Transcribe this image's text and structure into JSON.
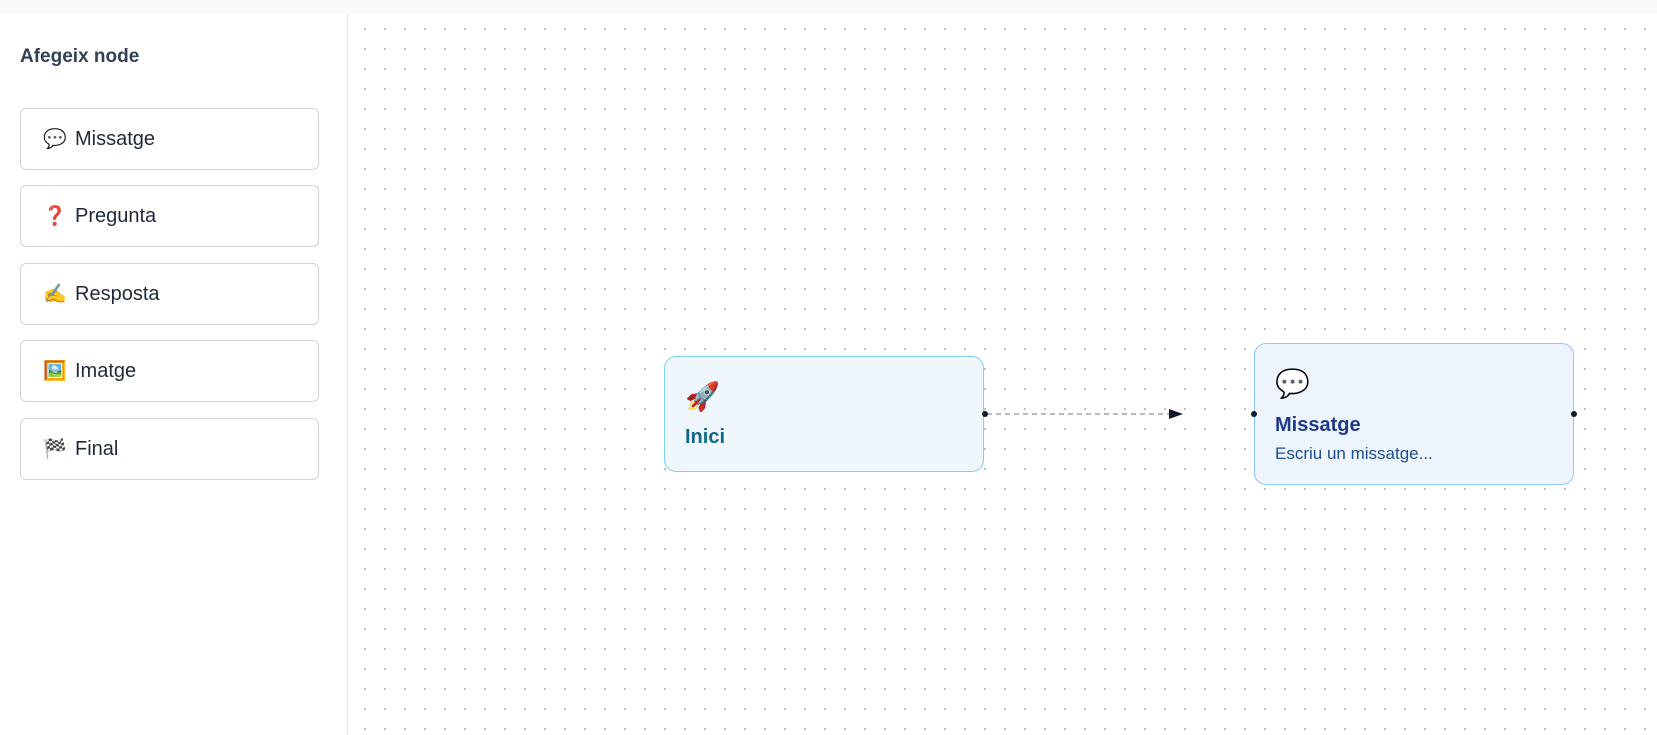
{
  "sidebar": {
    "title": "Afegeix node",
    "items": [
      {
        "icon": "💬",
        "icon_name": "speech-bubble-icon",
        "label": "Missatge"
      },
      {
        "icon": "❓",
        "icon_name": "question-mark-icon",
        "label": "Pregunta"
      },
      {
        "icon": "✍️",
        "icon_name": "writing-hand-icon",
        "label": "Resposta"
      },
      {
        "icon": "🖼️",
        "icon_name": "picture-icon",
        "label": "Imatge"
      },
      {
        "icon": "🏁",
        "icon_name": "checkered-flag-icon",
        "label": "Final"
      }
    ]
  },
  "flow": {
    "nodes": [
      {
        "id": "start",
        "icon": "🚀",
        "icon_name": "rocket-icon",
        "title": "Inici"
      },
      {
        "id": "message",
        "icon": "💬",
        "icon_name": "speech-bubble-icon",
        "title": "Missatge",
        "subtitle": "Escriu un missatge..."
      }
    ],
    "edges": [
      {
        "from": "start",
        "to": "message",
        "style": "dashed",
        "arrow": "end"
      }
    ]
  },
  "colors": {
    "start_node_border": "#7dd3e8",
    "start_node_bg": "#eff6fc",
    "message_node_border": "#93c5fd",
    "message_node_bg": "#edf4fd",
    "edge": "#9ca3af"
  }
}
